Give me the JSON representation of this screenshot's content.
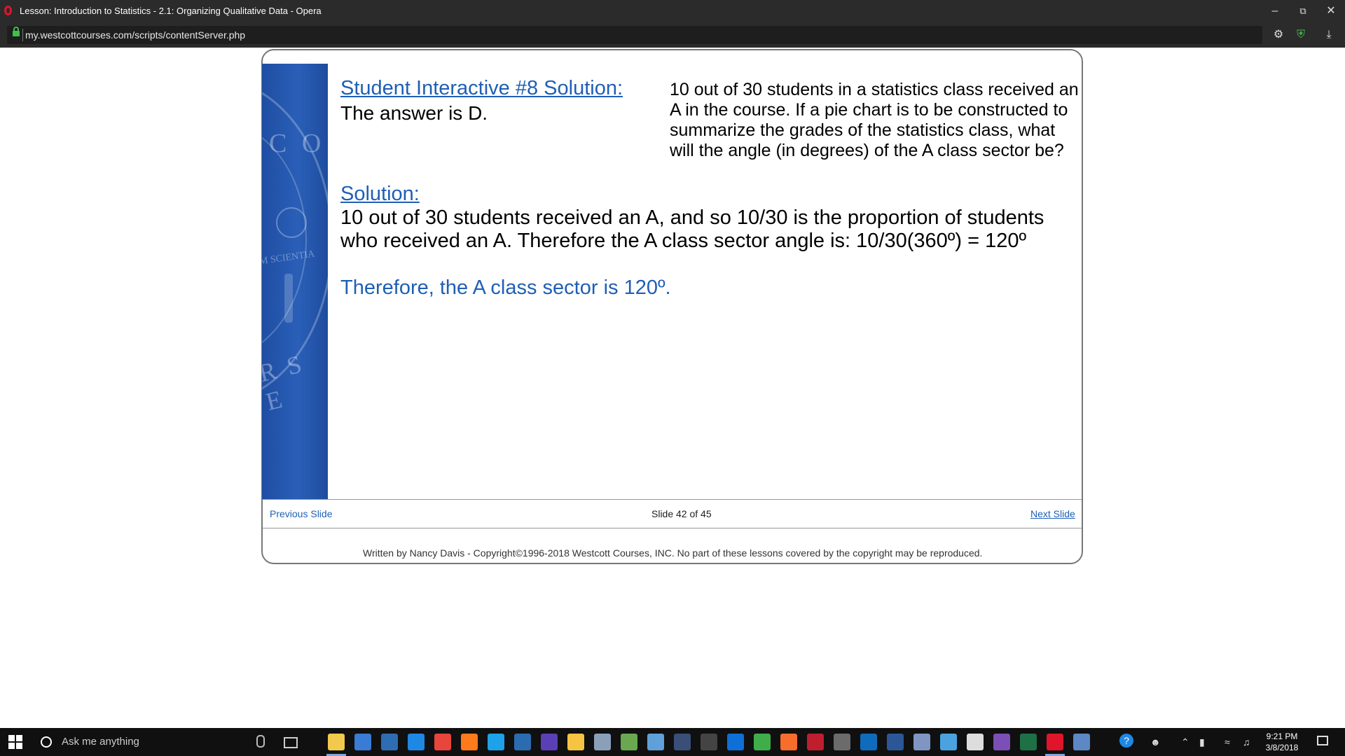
{
  "window": {
    "title": "Lesson: Introduction to Statistics - 2.1: Organizing Qualitative Data - Opera"
  },
  "browser": {
    "url": "my.westcottcourses.com/scripts/contentServer.php"
  },
  "slide": {
    "heading": "Student Interactive #8 Solution:",
    "answer": "The answer is D.",
    "question": "10 out of 30 students in a statistics class received an A in the course.  If a pie chart is to be constructed to summarize the grades of the statistics class, what will the angle (in degrees) of the A class sector be?",
    "solution_heading": "Solution:",
    "solution_text": "10 out of 30 students received an A, and so 10/30 is the proportion of students who received an A.  Therefore the A class sector angle is:  10/30(360º) = 120º",
    "conclusion": "Therefore, the A class sector is 120º.",
    "sidebar_seal_text": {
      "top": "C O",
      "middle": "M SCIENTIA",
      "bottom": "R S E"
    }
  },
  "navigation": {
    "previous": "Previous Slide",
    "counter": "Slide 42 of 45",
    "next": "Next Slide"
  },
  "footer": {
    "copyright": "Written by Nancy Davis - Copyright©1996-2018 Westcott Courses, INC. No part of these lessons covered by the copyright may be reproduced."
  },
  "taskbar": {
    "search_placeholder": "Ask me anything",
    "time": "9:21 PM",
    "date": "3/8/2018",
    "apps": [
      {
        "name": "file-explorer",
        "color": "#f2c94c"
      },
      {
        "name": "store",
        "color": "#3a7bd5"
      },
      {
        "name": "app-x",
        "color": "#2f6db3"
      },
      {
        "name": "edge",
        "color": "#1e88e5"
      },
      {
        "name": "chrome",
        "color": "#e8453c"
      },
      {
        "name": "firefox",
        "color": "#ff7a1a"
      },
      {
        "name": "internet-explorer",
        "color": "#1ea1e8"
      },
      {
        "name": "powershell",
        "color": "#2b6cb0"
      },
      {
        "name": "app-dp",
        "color": "#5b3fb6"
      },
      {
        "name": "app-star",
        "color": "#f6c343"
      },
      {
        "name": "app-bird",
        "color": "#8aa0b8"
      },
      {
        "name": "app-lambda",
        "color": "#6aa84f"
      },
      {
        "name": "app-book",
        "color": "#5fa0d8"
      },
      {
        "name": "app-camera",
        "color": "#3a4f78"
      },
      {
        "name": "calculator",
        "color": "#444444"
      },
      {
        "name": "teamviewer",
        "color": "#0e6fd6"
      },
      {
        "name": "camtasia",
        "color": "#3fae49"
      },
      {
        "name": "xampp",
        "color": "#f76d2b"
      },
      {
        "name": "filezilla",
        "color": "#bf1e2e"
      },
      {
        "name": "app-terminal",
        "color": "#6b6b6b"
      },
      {
        "name": "outlook",
        "color": "#0f6cbd"
      },
      {
        "name": "word",
        "color": "#2b5797"
      },
      {
        "name": "app-network",
        "color": "#7f96c2"
      },
      {
        "name": "app-monitor",
        "color": "#4aa3df"
      },
      {
        "name": "mail",
        "color": "#dddddd"
      },
      {
        "name": "visual-studio",
        "color": "#7b4fb6"
      },
      {
        "name": "excel",
        "color": "#1e7145"
      },
      {
        "name": "opera",
        "color": "#e0142a"
      },
      {
        "name": "app-window",
        "color": "#5c88c5"
      }
    ]
  },
  "colors": {
    "link": "#1f5fb5",
    "sidebar": "#2a5fb8",
    "chrome": "#2b2b2b"
  }
}
